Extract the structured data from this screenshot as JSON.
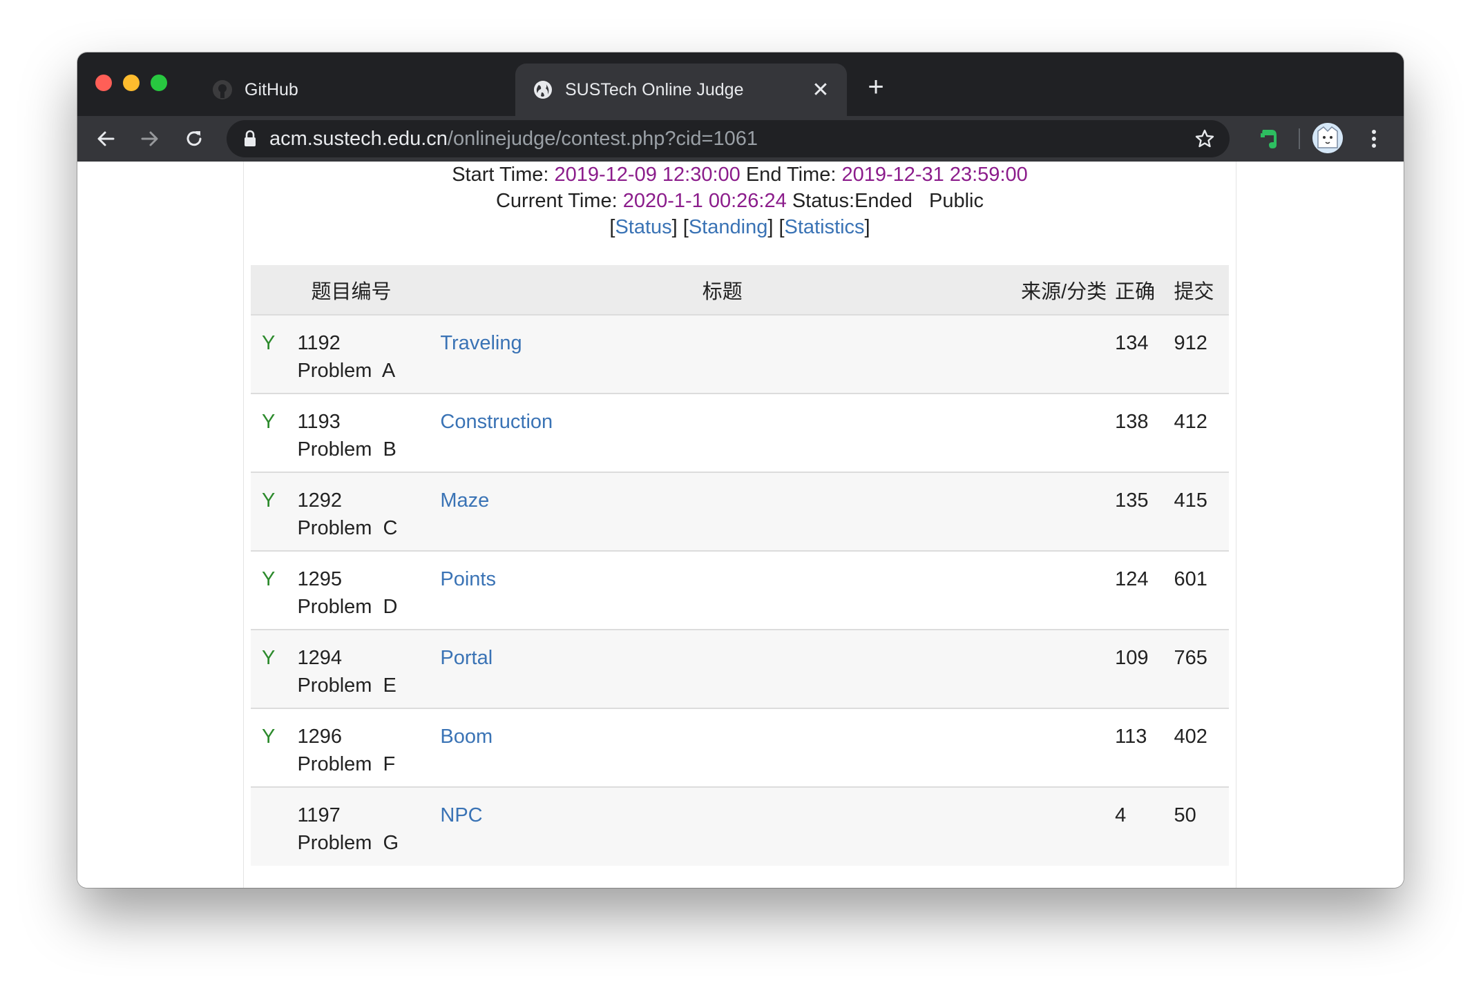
{
  "browser": {
    "tabs": [
      {
        "title": "GitHub",
        "icon": "github-icon",
        "active": false
      },
      {
        "title": "SUSTech Online Judge",
        "icon": "globe-icon",
        "active": true
      }
    ],
    "address": {
      "host": "acm.sustech.edu.cn",
      "path": "/onlinejudge/contest.php?cid=1061"
    }
  },
  "contest": {
    "start_label": "Start Time:",
    "start_time": "2019-12-09 12:30:00",
    "end_label": "End Time:",
    "end_time": "2019-12-31 23:59:00",
    "current_label": "Current Time:",
    "current_time": "2020-1-1 00:26:24",
    "status_text": "Status:Ended",
    "visibility": "Public",
    "links": {
      "status": "Status",
      "standing": "Standing",
      "statistics": "Statistics"
    }
  },
  "table": {
    "headers": {
      "id": "题目编号",
      "title": "标题",
      "source": "来源/分类",
      "accepted": "正确",
      "submitted": "提交"
    },
    "rows": [
      {
        "solved": "Y",
        "id": "1192",
        "label": "Problem  A",
        "title": "Traveling",
        "source": "",
        "accepted": "134",
        "submitted": "912"
      },
      {
        "solved": "Y",
        "id": "1193",
        "label": "Problem  B",
        "title": "Construction",
        "source": "",
        "accepted": "138",
        "submitted": "412"
      },
      {
        "solved": "Y",
        "id": "1292",
        "label": "Problem  C",
        "title": "Maze",
        "source": "",
        "accepted": "135",
        "submitted": "415"
      },
      {
        "solved": "Y",
        "id": "1295",
        "label": "Problem  D",
        "title": "Points",
        "source": "",
        "accepted": "124",
        "submitted": "601"
      },
      {
        "solved": "Y",
        "id": "1294",
        "label": "Problem  E",
        "title": "Portal",
        "source": "",
        "accepted": "109",
        "submitted": "765"
      },
      {
        "solved": "Y",
        "id": "1296",
        "label": "Problem  F",
        "title": "Boom",
        "source": "",
        "accepted": "113",
        "submitted": "402"
      },
      {
        "solved": "",
        "id": "1197",
        "label": "Problem  G",
        "title": "NPC",
        "source": "",
        "accepted": "4",
        "submitted": "50"
      }
    ]
  },
  "colors": {
    "time_purple": "#8b1c8b",
    "link_blue": "#3a73b5",
    "solved_green": "#2c8a2c"
  }
}
